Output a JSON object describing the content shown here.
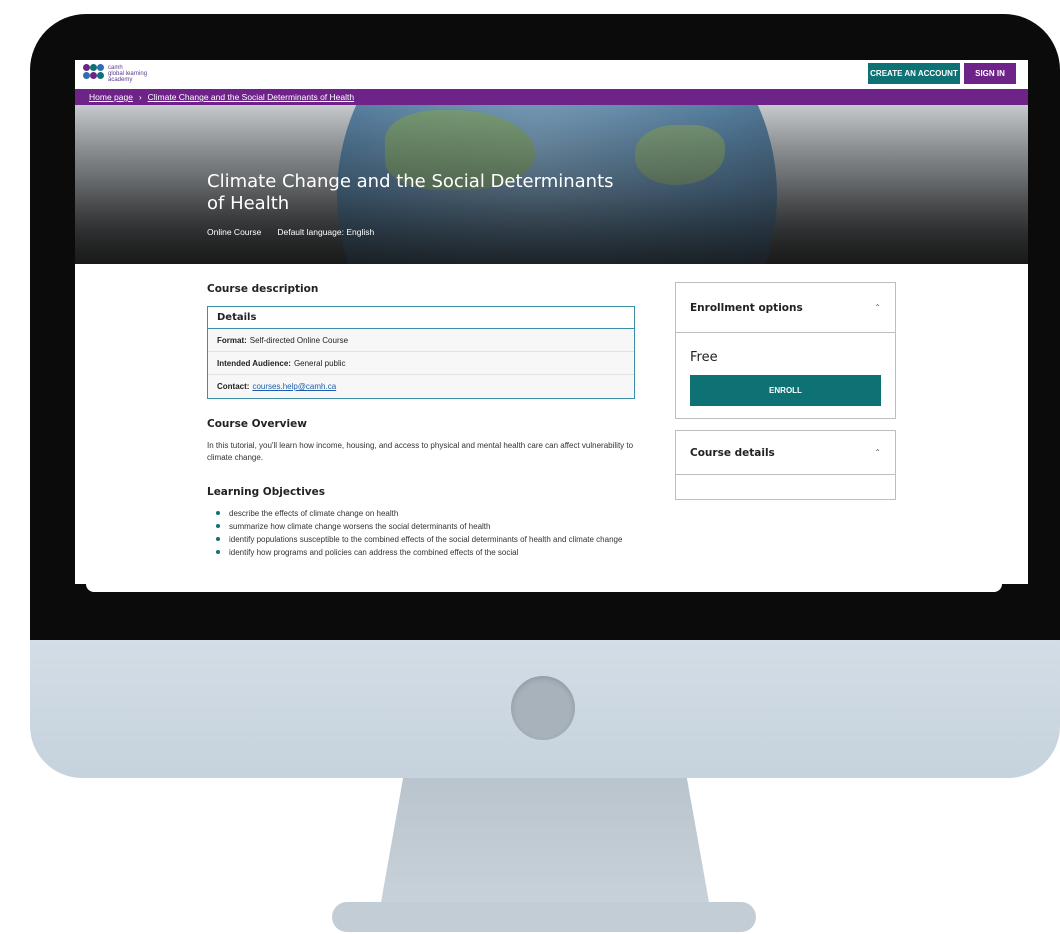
{
  "header": {
    "logo_line1": "camh",
    "logo_line2": "global learning",
    "logo_line3": "academy",
    "create_account_label": "CREATE AN ACCOUNT",
    "sign_in_label": "SIGN IN"
  },
  "breadcrumb": {
    "home": "Home page",
    "separator": "›",
    "current": "Climate Change and the Social Determinants of Health"
  },
  "hero": {
    "title": "Climate Change and the Social Determinants of Health",
    "course_type": "Online Course",
    "language": "Default language: English"
  },
  "description": {
    "heading": "Course description",
    "details_heading": "Details",
    "format_label": "Format:",
    "format_value": "Self-directed Online Course",
    "audience_label": "Intended Audience:",
    "audience_value": "General public",
    "contact_label": "Contact:",
    "contact_value": "courses.help@camh.ca"
  },
  "overview": {
    "heading": "Course Overview",
    "text": "In this tutorial, you'll learn how income, housing, and access to physical and mental health care can affect vulnerability to climate change."
  },
  "objectives": {
    "heading": "Learning Objectives",
    "items": [
      "describe the effects of climate change on health",
      "summarize how climate change worsens the social determinants of health",
      "identify populations susceptible to the combined effects of the social determinants of health and climate change",
      "identify how programs and policies can address the combined effects of the social"
    ]
  },
  "enrollment": {
    "heading": "Enrollment options",
    "price": "Free",
    "enroll_label": "ENROLL"
  },
  "course_details": {
    "heading": "Course details"
  },
  "colors": {
    "teal": "#0e7173",
    "purple": "#6d2387",
    "details_border": "#3b8ea5"
  },
  "icons": {
    "chevron": "chevron-up-icon",
    "bullet": "bullet-icon"
  }
}
